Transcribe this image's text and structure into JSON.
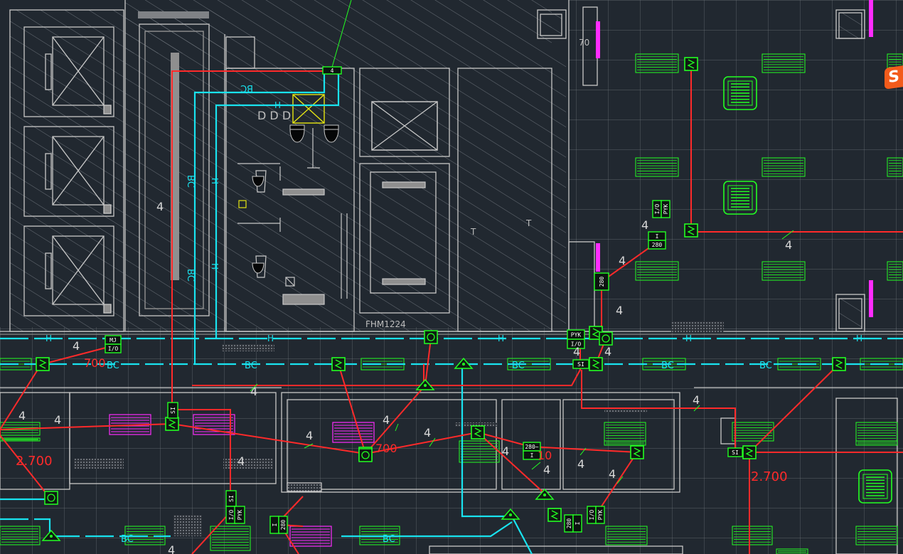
{
  "labels": {
    "bc": "BC",
    "h": "H",
    "circuit_4": "4",
    "elevation": "2.700",
    "elevation_partial": "700",
    "door_tag": "FHM1224",
    "floor_partial": "70",
    "badge_sign": "4",
    "sl": "SI",
    "mj": "MJ",
    "io": "I/O",
    "pyk": "PYK",
    "dev_280": "280",
    "dev_i": "I",
    "dev_280c": "280~",
    "floor_num": "10",
    "dots": "D D D",
    "letter_t": "T",
    "small_4": "4",
    "brand_s": "S"
  },
  "colors": {
    "background": "#212830",
    "wire": "#ff2a2a",
    "conduit": "#19e3ef",
    "device": "#22ff22",
    "panel": "#ff2cff",
    "wall": "#c8c8c8",
    "hatch": "#8a9096",
    "yellow": "#e5e512",
    "grid": "#8c8c8c"
  },
  "icons": [
    "sensor-icon",
    "smoke-detector-icon",
    "light-fixture-icon",
    "fan-coil-icon",
    "elevator-icon",
    "toilet-icon",
    "speaker-icon"
  ]
}
